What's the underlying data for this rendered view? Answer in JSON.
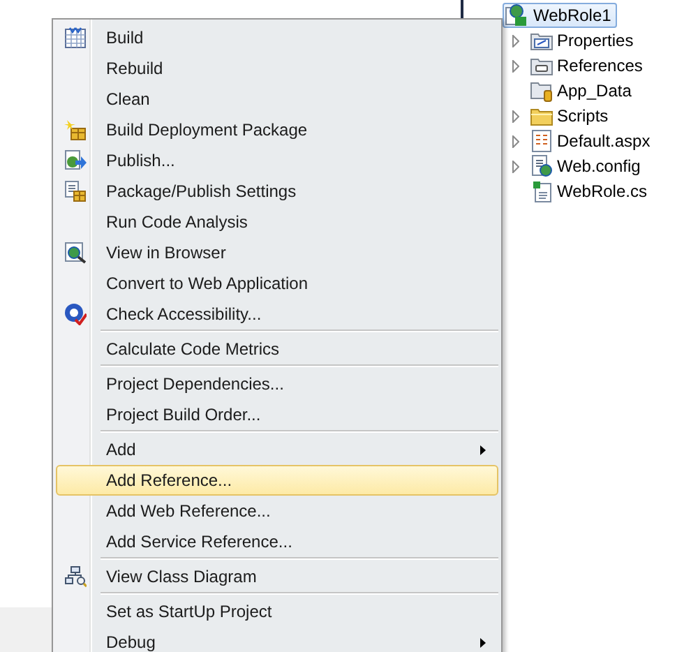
{
  "context_menu": {
    "items": [
      {
        "kind": "item",
        "label": "Build",
        "selected": false,
        "submenu": false
      },
      {
        "kind": "item",
        "label": "Rebuild",
        "selected": false,
        "submenu": false
      },
      {
        "kind": "item",
        "label": "Clean",
        "selected": false,
        "submenu": false
      },
      {
        "kind": "item",
        "label": "Build Deployment Package",
        "selected": false,
        "submenu": false
      },
      {
        "kind": "item",
        "label": "Publish...",
        "selected": false,
        "submenu": false
      },
      {
        "kind": "item",
        "label": "Package/Publish Settings",
        "selected": false,
        "submenu": false
      },
      {
        "kind": "item",
        "label": "Run Code Analysis",
        "selected": false,
        "submenu": false
      },
      {
        "kind": "item",
        "label": "View in Browser",
        "selected": false,
        "submenu": false
      },
      {
        "kind": "item",
        "label": "Convert to Web Application",
        "selected": false,
        "submenu": false
      },
      {
        "kind": "item",
        "label": "Check Accessibility...",
        "selected": false,
        "submenu": false
      },
      {
        "kind": "separator"
      },
      {
        "kind": "item",
        "label": "Calculate Code Metrics",
        "selected": false,
        "submenu": false
      },
      {
        "kind": "separator"
      },
      {
        "kind": "item",
        "label": "Project Dependencies...",
        "selected": false,
        "submenu": false
      },
      {
        "kind": "item",
        "label": "Project Build Order...",
        "selected": false,
        "submenu": false
      },
      {
        "kind": "separator"
      },
      {
        "kind": "item",
        "label": "Add",
        "selected": false,
        "submenu": true
      },
      {
        "kind": "item",
        "label": "Add Reference...",
        "selected": true,
        "submenu": false
      },
      {
        "kind": "item",
        "label": "Add Web Reference...",
        "selected": false,
        "submenu": false
      },
      {
        "kind": "item",
        "label": "Add Service Reference...",
        "selected": false,
        "submenu": false
      },
      {
        "kind": "separator"
      },
      {
        "kind": "item",
        "label": "View Class Diagram",
        "selected": false,
        "submenu": false
      },
      {
        "kind": "separator"
      },
      {
        "kind": "item",
        "label": "Set as StartUp Project",
        "selected": false,
        "submenu": false
      },
      {
        "kind": "item",
        "label": "Debug",
        "selected": false,
        "submenu": true
      }
    ]
  },
  "solution_tree": {
    "root": {
      "label": "WebRole1",
      "selected": true,
      "children": [
        {
          "label": "Properties",
          "expandable": true
        },
        {
          "label": "References",
          "expandable": true
        },
        {
          "label": "App_Data",
          "expandable": false
        },
        {
          "label": "Scripts",
          "expandable": true
        },
        {
          "label": "Default.aspx",
          "expandable": true
        },
        {
          "label": "Web.config",
          "expandable": true
        },
        {
          "label": "WebRole.cs",
          "expandable": false
        }
      ]
    }
  }
}
